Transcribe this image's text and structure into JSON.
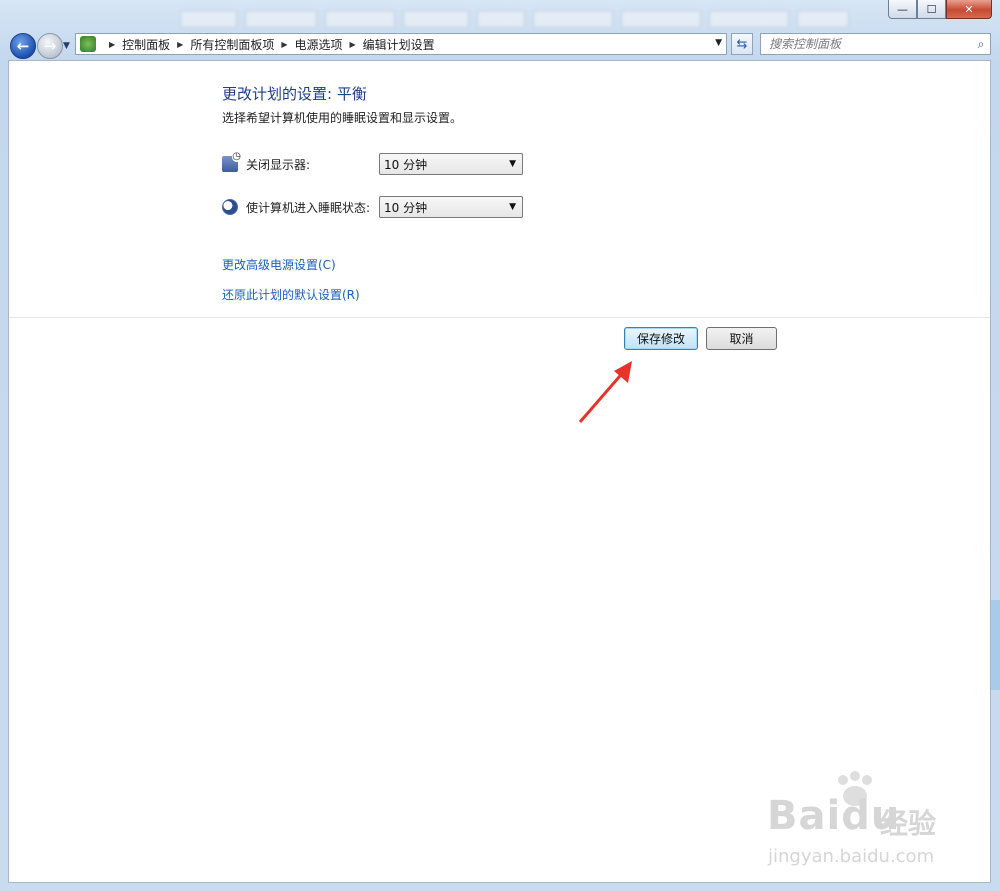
{
  "window": {
    "caption": {
      "minimize": "—",
      "maximize": "☐",
      "close": "✕"
    }
  },
  "navbar": {
    "back_icon": "arrow-left-icon",
    "forward_icon": "arrow-right-icon",
    "breadcrumbs": [
      "控制面板",
      "所有控制面板项",
      "电源选项",
      "编辑计划设置"
    ],
    "search_placeholder": "搜索控制面板"
  },
  "main": {
    "title": "更改计划的设置: 平衡",
    "subtitle": "选择希望计算机使用的睡眠设置和显示设置。",
    "settings": [
      {
        "label": "关闭显示器:",
        "value": "10 分钟",
        "icon": "monitor-icon"
      },
      {
        "label": "使计算机进入睡眠状态:",
        "value": "10 分钟",
        "icon": "moon-icon"
      }
    ],
    "links": {
      "advanced": "更改高级电源设置(C)",
      "restore": "还原此计划的默认设置(R)"
    },
    "buttons": {
      "save": "保存修改",
      "cancel": "取消"
    },
    "annotation_color": "#e8332b"
  },
  "watermark": {
    "brand": "Baidu",
    "brand_cn": "经验",
    "url": "jingyan.baidu.com"
  }
}
